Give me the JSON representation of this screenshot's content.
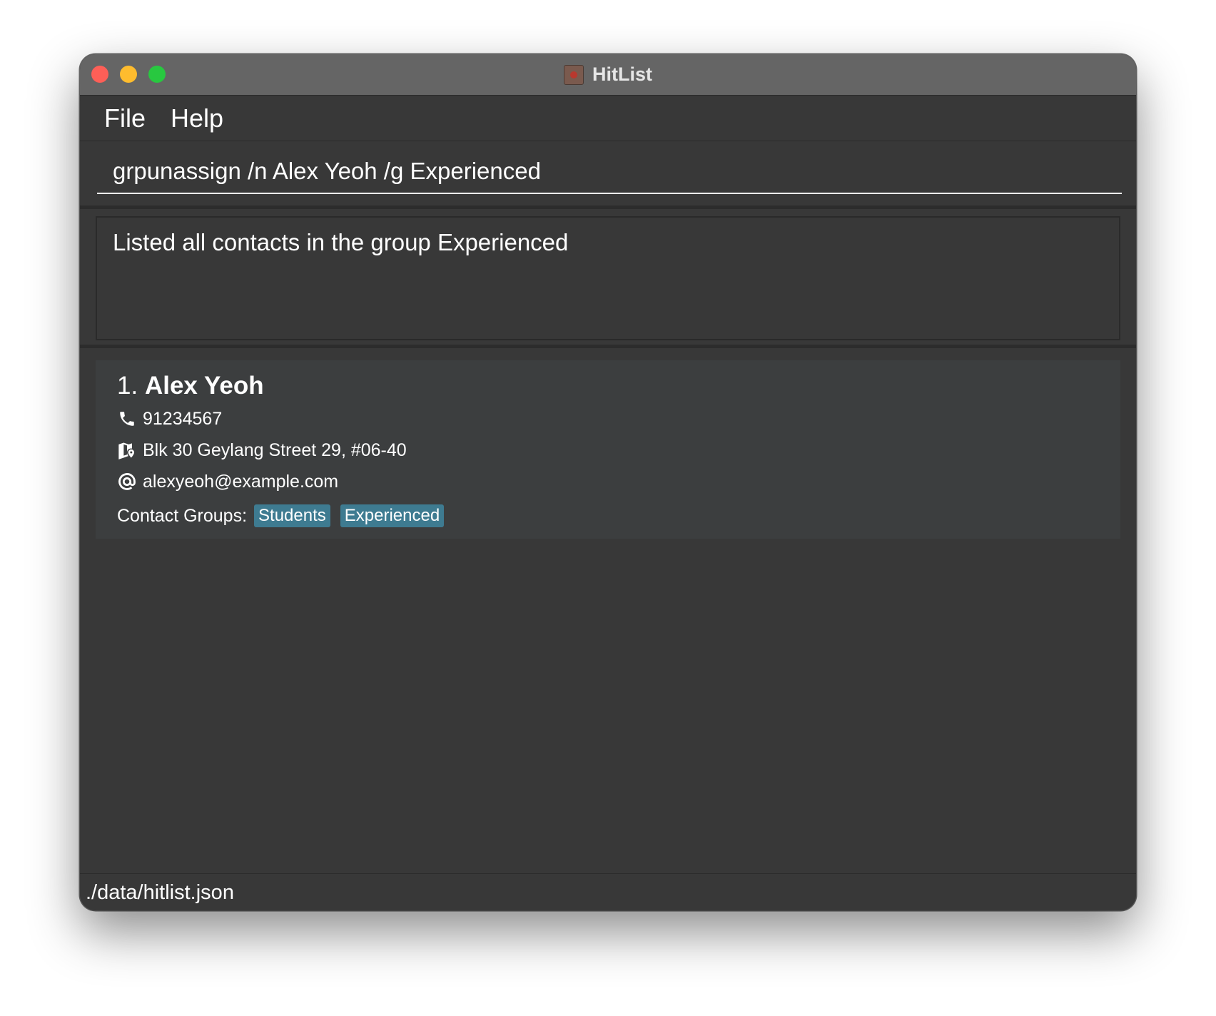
{
  "window": {
    "title": "HitList",
    "app_icon": "hitlist-app-icon"
  },
  "menu": {
    "file": "File",
    "help": "Help"
  },
  "command": {
    "value": "grpunassign /n Alex Yeoh /g Experienced"
  },
  "result": {
    "message": "Listed all contacts in the group Experienced"
  },
  "contacts": [
    {
      "index": "1.",
      "name": "Alex Yeoh",
      "phone": "91234567",
      "address": "Blk 30 Geylang Street 29, #06-40",
      "email": "alexyeoh@example.com",
      "groups_label": "Contact Groups:",
      "groups": [
        "Students",
        "Experienced"
      ]
    }
  ],
  "status": {
    "path": "./data/hitlist.json"
  },
  "colors": {
    "background": "#383838",
    "titlebar": "#656565",
    "card": "#3c3e3f",
    "tag": "#3e7b91",
    "close": "#fe5f57",
    "minimize": "#febc2e",
    "maximize": "#28c840"
  }
}
